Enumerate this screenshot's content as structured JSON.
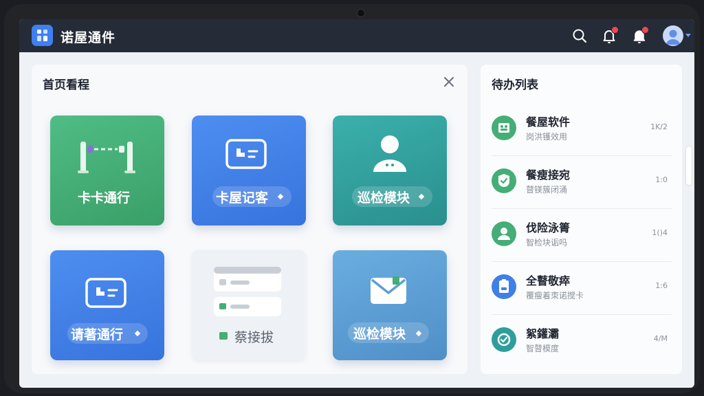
{
  "app": {
    "title": "诺屋通件"
  },
  "header": {
    "icons": [
      "search-icon",
      "bell-icon",
      "bell-icon",
      "avatar",
      "chevron-down-icon"
    ]
  },
  "left_panel": {
    "title": "首页看程",
    "tiles": [
      {
        "label": "卡卡通行",
        "icon": "turnstile-gate-icon",
        "color": "#45ad76"
      },
      {
        "label": "卡屋记客",
        "icon": "id-card-icon",
        "color": "#3f7fe6"
      },
      {
        "label": "巡检模块",
        "icon": "user-icon",
        "color": "#2e9e9c"
      },
      {
        "label": "请著通行",
        "icon": "id-card-icon",
        "color": "#3f7fe6"
      },
      {
        "label": "蔡接拔",
        "icon": "list-card-icon",
        "color": "#eef2f6"
      },
      {
        "label": "巡检模块",
        "icon": "mail-icon",
        "color": "#5f9ed6"
      }
    ]
  },
  "right_panel": {
    "title": "待办列表",
    "items": [
      {
        "title": "餐屋软件",
        "subtitle": "岗洪镬效用",
        "value": "1K/2",
        "icon": "team-icon",
        "color": "#45ad76"
      },
      {
        "title": "餐瘦接宛",
        "subtitle": "瞽镁簇闭涌",
        "value": "1:0",
        "icon": "shield-check-icon",
        "color": "#45ad76"
      },
      {
        "title": "伐险泳箐",
        "subtitle": "智检块诟吗",
        "value": "1()4",
        "icon": "user-icon",
        "color": "#45ad76"
      },
      {
        "title": "全瞽敬瘁",
        "subtitle": "覆瘦着朿诺搅卡",
        "value": "1:6",
        "icon": "id-badge-icon",
        "color": "#3f7fe6"
      },
      {
        "title": "絮鑵灞",
        "subtitle": "智瞽模度",
        "value": "4/M",
        "icon": "check-circle-icon",
        "color": "#2e9e9c"
      }
    ]
  }
}
